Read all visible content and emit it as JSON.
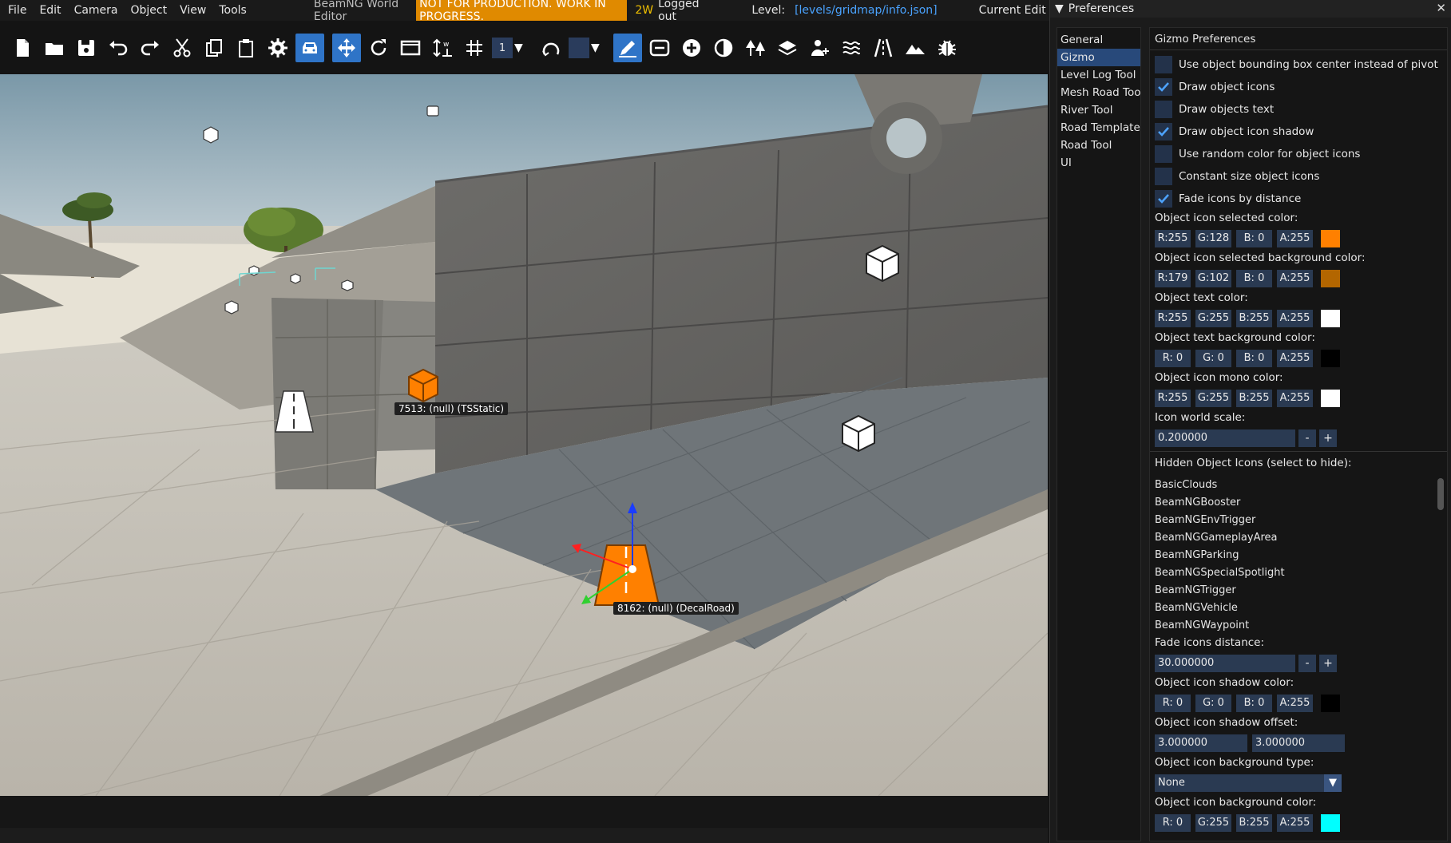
{
  "menu": [
    "File",
    "Edit",
    "Camera",
    "Object",
    "View",
    "Tools"
  ],
  "app_title": "BeamNG World Editor",
  "warning": "NOT FOR PRODUCTION. WORK IN PROGRESS.",
  "mode": "2W",
  "login_status": "Logged out",
  "level_label": "Level:",
  "level_path": "[levels/gridmap/info.json]",
  "edit_mode": "Current Edit Mod",
  "toolbar": {
    "snap_value": "1",
    "icons": [
      "new-file",
      "open-folder",
      "save",
      "undo",
      "redo",
      "cut",
      "copy",
      "paste",
      "settings",
      "vehicle",
      "move",
      "rotate",
      "window",
      "align",
      "grid-snap",
      "snap-value",
      "rotate-snap",
      "color",
      "edit",
      "decal-road",
      "add",
      "terrain",
      "forest",
      "layers",
      "spawn",
      "river",
      "road",
      "mountain",
      "debug"
    ]
  },
  "labels": {
    "tsstatic": "7513: (null) (TSStatic)",
    "decalroad": "8162: (null) (DecalRoad)"
  },
  "prefs": {
    "title": "Preferences",
    "close": "✕",
    "nav": [
      "General",
      "Gizmo",
      "Level Log Tool",
      "Mesh Road Tool",
      "River Tool",
      "Road Templates",
      "Road Tool",
      "UI"
    ],
    "selected_nav": "Gizmo",
    "section_title": "Gizmo Preferences",
    "checkboxes": [
      {
        "label": "Use object bounding box center instead of pivot",
        "checked": false
      },
      {
        "label": "Draw object icons",
        "checked": true
      },
      {
        "label": "Draw objects text",
        "checked": false
      },
      {
        "label": "Draw object icon shadow",
        "checked": true
      },
      {
        "label": "Use random color for object icons",
        "checked": false
      },
      {
        "label": "Constant size object icons",
        "checked": false
      },
      {
        "label": "Fade icons by distance",
        "checked": true
      }
    ],
    "colors_top": [
      {
        "label": "Object icon selected color:",
        "r": "R:255",
        "g": "G:128",
        "b": "B: 0",
        "a": "A:255",
        "swatch": "#ff8000"
      },
      {
        "label": "Object icon selected background color:",
        "r": "R:179",
        "g": "G:102",
        "b": "B: 0",
        "a": "A:255",
        "swatch": "#b36600"
      },
      {
        "label": "Object text color:",
        "r": "R:255",
        "g": "G:255",
        "b": "B:255",
        "a": "A:255",
        "swatch": "#ffffff"
      },
      {
        "label": "Object text background color:",
        "r": "R: 0",
        "g": "G: 0",
        "b": "B: 0",
        "a": "A:255",
        "swatch": "#000000"
      },
      {
        "label": "Object icon mono color:",
        "r": "R:255",
        "g": "G:255",
        "b": "B:255",
        "a": "A:255",
        "swatch": "#ffffff"
      }
    ],
    "icon_world_scale_label": "Icon world scale:",
    "icon_world_scale": "0.200000",
    "minus": "-",
    "plus": "+",
    "hidden_label": "Hidden Object Icons (select to hide):",
    "hidden_list": [
      "BasicClouds",
      "BeamNGBooster",
      "BeamNGEnvTrigger",
      "BeamNGGameplayArea",
      "BeamNGParking",
      "BeamNGSpecialSpotlight",
      "BeamNGTrigger",
      "BeamNGVehicle",
      "BeamNGWaypoint"
    ],
    "fade_distance_label": "Fade icons distance:",
    "fade_distance": "30.000000",
    "shadow_color": {
      "label": "Object icon shadow color:",
      "r": "R: 0",
      "g": "G: 0",
      "b": "B: 0",
      "a": "A:255",
      "swatch": "#000000"
    },
    "shadow_offset_label": "Object icon shadow offset:",
    "shadow_offset_x": "3.000000",
    "shadow_offset_y": "3.000000",
    "bg_type_label": "Object icon background type:",
    "bg_type": "None",
    "bg_color": {
      "label": "Object icon background color:",
      "r": "R: 0",
      "g": "G:255",
      "b": "B:255",
      "a": "A:255",
      "swatch": "#00ffff"
    }
  }
}
